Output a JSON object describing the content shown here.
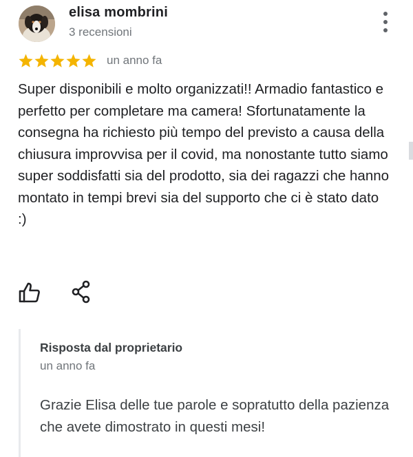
{
  "review": {
    "author_name": "elisa mombrini",
    "review_count": "3 recensioni",
    "rating": 5,
    "rating_max": 5,
    "date": "un anno fa",
    "text": "Super disponibili e molto organizzati!! Armadio fantastico e perfetto per completare ma camera! Sfortunatamente la consegna ha richiesto più tempo del previsto a causa della chiusura improvvisa per il covid, ma nonostante tutto siamo super soddisfatti sia del prodotto, sia dei ragazzi che hanno montato in tempi brevi sia del supporto che ci è stato dato :)"
  },
  "actions": {
    "like_icon": "thumbs-up-icon",
    "share_icon": "share-icon",
    "menu_icon": "more-vert-icon"
  },
  "owner_response": {
    "title": "Risposta dal proprietario",
    "date": "un anno fa",
    "text": "Grazie Elisa delle tue parole e sopratutto della pazienza che avete dimostrato in questi mesi!"
  },
  "colors": {
    "star": "#f4b400",
    "secondary_text": "#70757a",
    "primary_text": "#202124",
    "icon": "#202124"
  }
}
